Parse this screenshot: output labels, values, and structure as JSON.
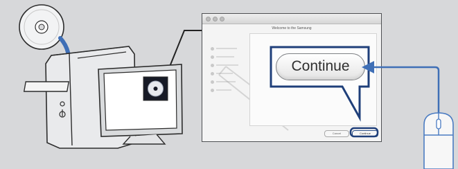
{
  "window": {
    "title": "Welcome to the Samsung",
    "cancel_label": "Cancel",
    "continue_label": "Continue"
  },
  "callout": {
    "continue_label": "Continue"
  },
  "icons": [
    "cd-icon",
    "insert-arrow-icon",
    "computer-tower-icon",
    "monitor-icon",
    "installer-disc-icon",
    "mouse-icon",
    "click-arrow-icon"
  ],
  "colors": {
    "background": "#d7d8da",
    "callout_border": "#1f3f7a",
    "arrow": "#3f6fb6"
  }
}
